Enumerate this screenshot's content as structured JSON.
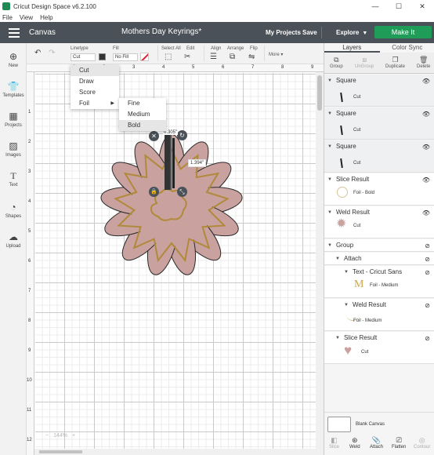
{
  "titlebar": {
    "title": "Cricut Design Space  v6.2.100",
    "min": "—",
    "max": "☐",
    "close": "✕"
  },
  "menubar": {
    "items": [
      "File",
      "View",
      "Help"
    ]
  },
  "header": {
    "canvas_label": "Canvas",
    "project_title": "Mothers Day Keyrings*",
    "my_projects": "My Projects",
    "save": "Save",
    "explore": "Explore",
    "make_it": "Make It"
  },
  "toolbar": {
    "linetype_label": "Linetype",
    "linetype_value": "Cut",
    "fill_label": "Fill",
    "fill_value": "No Fill",
    "select_all": "Select All",
    "edit": "Edit",
    "align": "Align",
    "arrange": "Arrange",
    "flip": "Flip",
    "more": "More ▾"
  },
  "leftbar": {
    "items": [
      "New",
      "Templates",
      "Projects",
      "Images",
      "Text",
      "Shapes",
      "Upload"
    ]
  },
  "rulers": {
    "top": [
      "1",
      "2",
      "3",
      "4",
      "5",
      "6",
      "7",
      "8",
      "9"
    ],
    "left": [
      "1",
      "2",
      "3",
      "4",
      "5",
      "6",
      "7",
      "8",
      "9",
      "10",
      "11",
      "12"
    ]
  },
  "linetype_menu": {
    "items": [
      "Cut",
      "Draw",
      "Score",
      "Foil"
    ]
  },
  "foil_menu": {
    "items": [
      "Fine",
      "Medium",
      "Bold"
    ]
  },
  "dimensions": {
    "width": "0.305\"",
    "height": "1.394\""
  },
  "zoom": {
    "minus": "−",
    "value": "144%",
    "plus": "+"
  },
  "rightpanel": {
    "tabs": [
      "Layers",
      "Color Sync"
    ],
    "actions": [
      "Group",
      "UnGroup",
      "Duplicate",
      "Delete"
    ],
    "layers": [
      {
        "title": "Square",
        "sub": "Cut"
      },
      {
        "title": "Square",
        "sub": "Cut"
      },
      {
        "title": "Square",
        "sub": "Cut"
      },
      {
        "title": "Slice Result",
        "sub": "Foil - Bold"
      },
      {
        "title": "Weld Result",
        "sub": "Cut"
      },
      {
        "title": "Group"
      },
      {
        "title": "Attach"
      },
      {
        "title": "Text - Cricut Sans",
        "sub": "Foil - Medium"
      },
      {
        "title": "Weld Result",
        "sub": "Foil - Medium"
      },
      {
        "title": "Slice Result",
        "sub": "Cut"
      }
    ],
    "blank_canvas": "Blank Canvas",
    "bottom_actions": [
      "Slice",
      "Weld",
      "Attach",
      "Flatten",
      "Contour"
    ]
  },
  "colors": {
    "header": "#4a5158",
    "make_it": "#1f9c58",
    "flower": "#c9a19f",
    "foil": "#b08a3a"
  }
}
